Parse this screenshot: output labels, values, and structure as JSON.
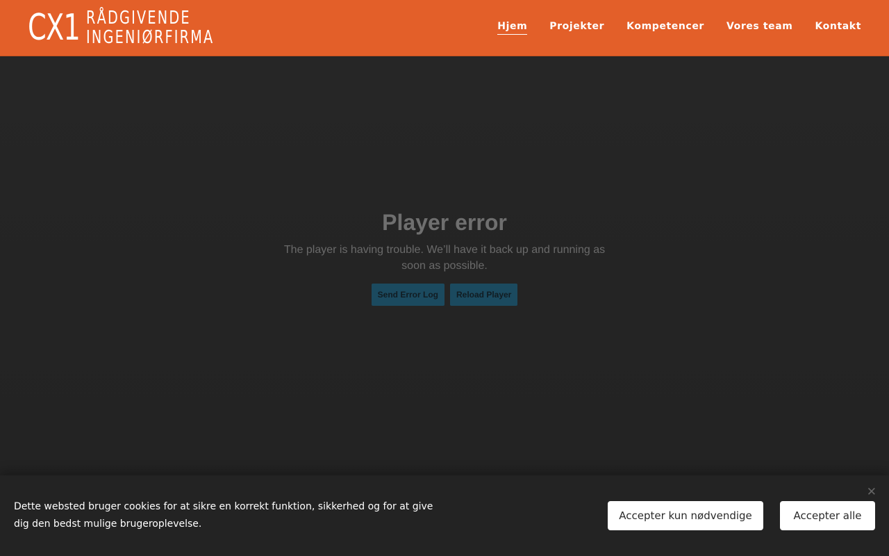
{
  "header": {
    "logo_mark": "CX1",
    "logo_line1": "RÅDGIVENDE",
    "logo_line2": "INGENIØRFIRMA",
    "nav": [
      {
        "label": "Hjem",
        "active": true
      },
      {
        "label": "Projekter"
      },
      {
        "label": "Kompetencer"
      },
      {
        "label": "Vores team"
      },
      {
        "label": "Kontakt"
      }
    ]
  },
  "player": {
    "title": "Player error",
    "message": "The player is having trouble. We’ll have it back up and running as soon as possible.",
    "send_log_label": "Send Error Log",
    "reload_label": "Reload Player"
  },
  "cookie": {
    "text": "Dette websted bruger cookies for at sikre en korrekt funktion, sikkerhed og for at give dig den bedst mulige brugeroplevelse.",
    "close_symbol": "✕",
    "accept_necessary_label": "Accepter kun nødvendige",
    "accept_all_label": "Accepter alle"
  },
  "colors": {
    "brand_orange": "#e35f29",
    "background": "#252525",
    "player_button": "#1b4a5f"
  }
}
